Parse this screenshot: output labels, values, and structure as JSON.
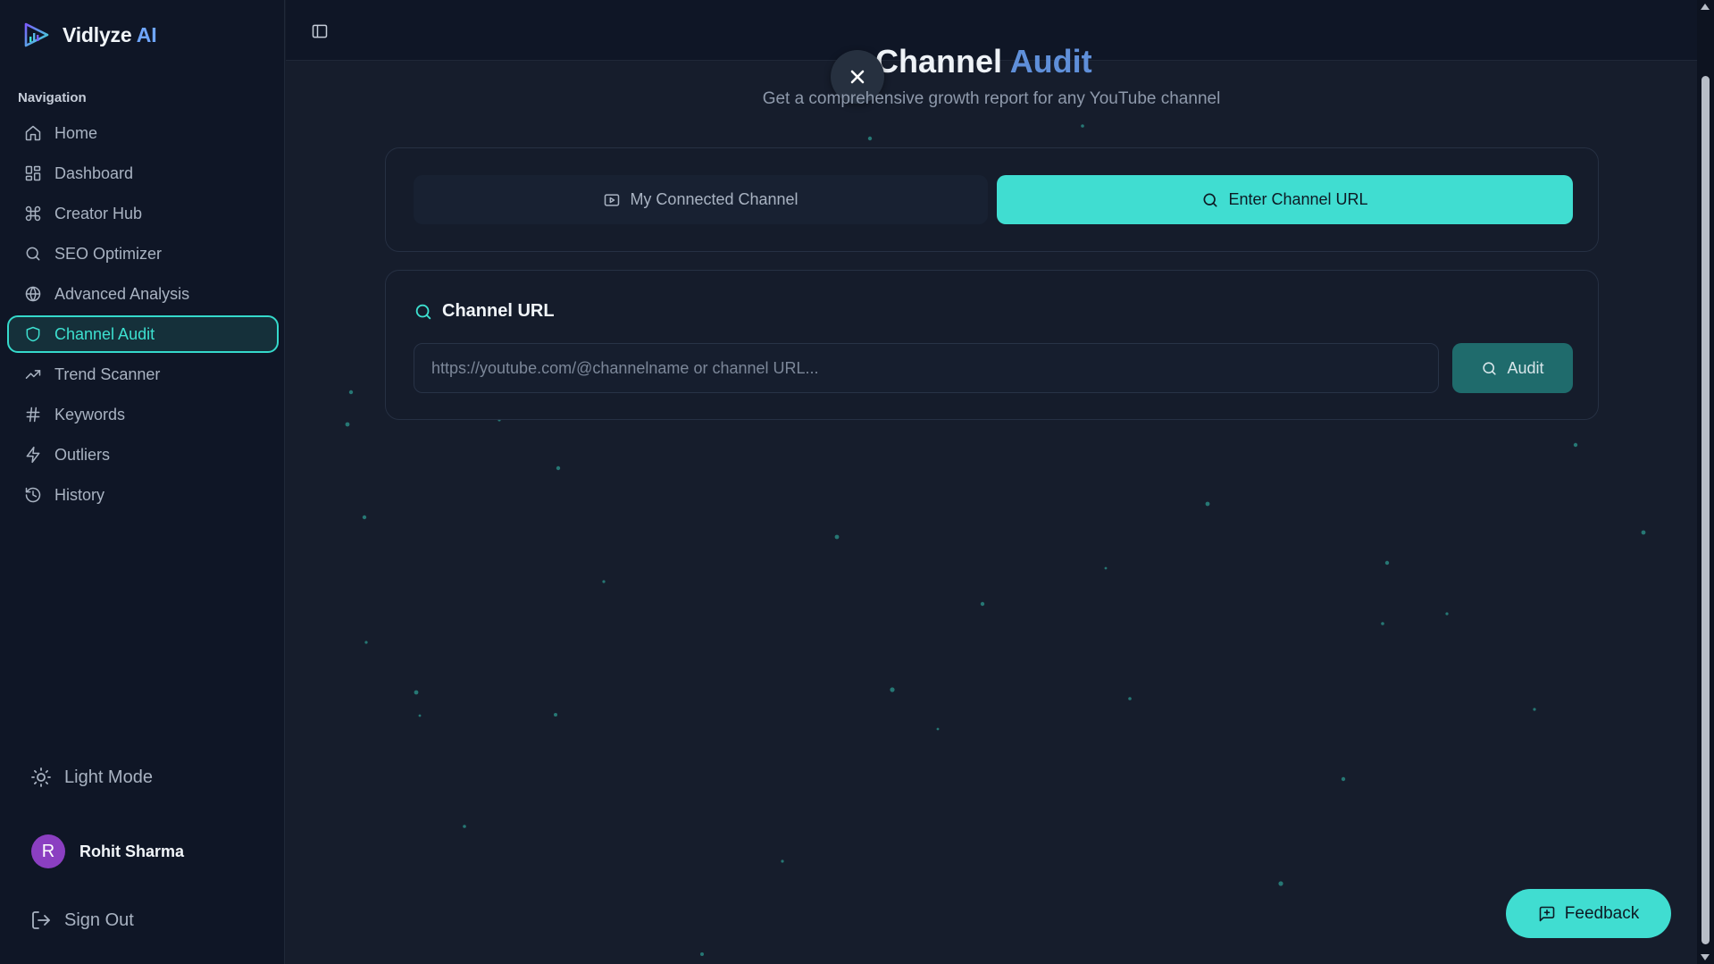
{
  "brand": {
    "name": "Vidlyze",
    "suffix": "AI"
  },
  "nav": {
    "heading": "Navigation",
    "items": [
      {
        "label": "Home",
        "icon": "home-icon"
      },
      {
        "label": "Dashboard",
        "icon": "dashboard-icon"
      },
      {
        "label": "Creator Hub",
        "icon": "command-icon"
      },
      {
        "label": "SEO Optimizer",
        "icon": "search-icon"
      },
      {
        "label": "Advanced Analysis",
        "icon": "globe-icon"
      },
      {
        "label": "Channel Audit",
        "icon": "shield-icon",
        "active": true
      },
      {
        "label": "Trend Scanner",
        "icon": "trending-up-icon"
      },
      {
        "label": "Keywords",
        "icon": "hash-icon"
      },
      {
        "label": "Outliers",
        "icon": "zap-icon"
      },
      {
        "label": "History",
        "icon": "history-icon"
      }
    ]
  },
  "footer": {
    "theme_toggle": "Light Mode",
    "user": {
      "initial": "R",
      "name": "Rohit Sharma"
    },
    "sign_out": "Sign Out"
  },
  "page": {
    "title_part1": "Channel",
    "title_part2": "Audit",
    "subtitle": "Get a comprehensive growth report for any YouTube channel"
  },
  "tabs": {
    "connected": "My Connected Channel",
    "url": "Enter Channel URL",
    "selected": "url"
  },
  "url_card": {
    "heading": "Channel URL",
    "input_value": "",
    "input_placeholder": "https://youtube.com/@channelname or channel URL...",
    "audit_label": "Audit"
  },
  "feedback": {
    "label": "Feedback"
  },
  "colors": {
    "accent": "#40ddd1",
    "sidebar_bg": "#0f1626",
    "main_bg": "#161d2c",
    "audit_button": "#1f6b6c",
    "avatar": "#8b3fc1"
  }
}
